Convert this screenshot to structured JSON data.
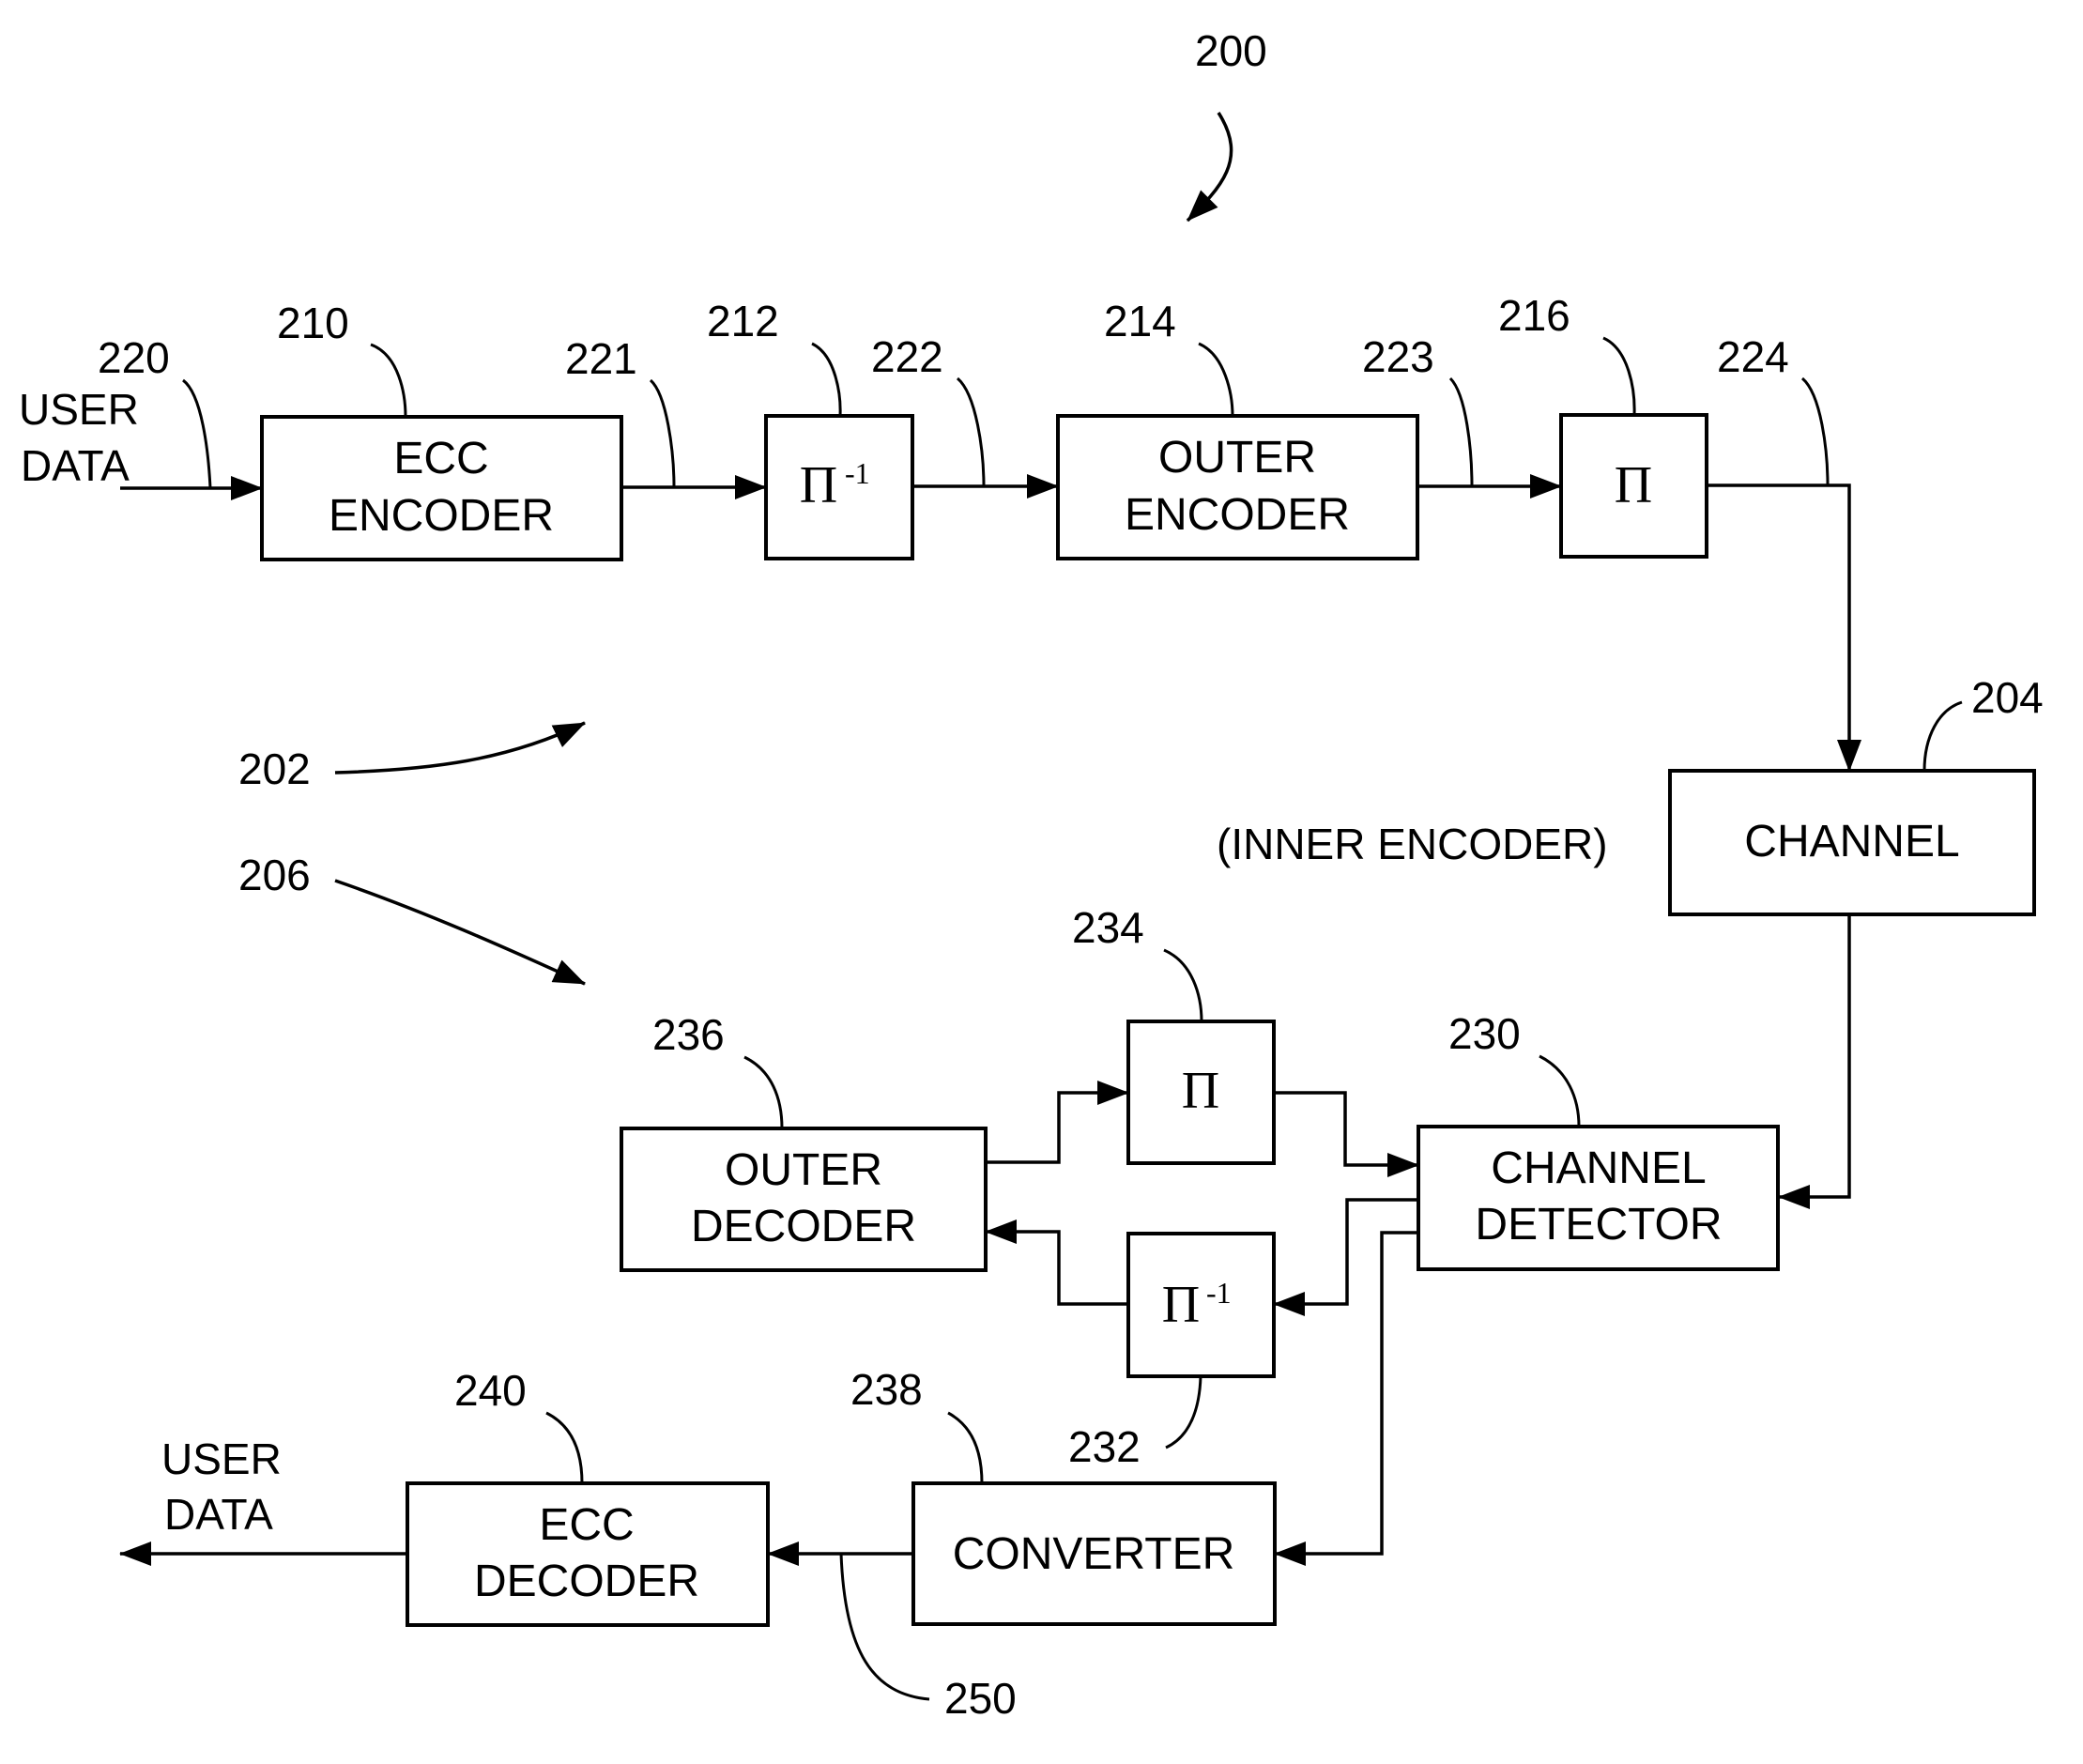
{
  "figure": {
    "ref": "200",
    "encoder_ref": "202",
    "channel_ref": "204",
    "decoder_ref": "206"
  },
  "blocks": {
    "ecc_encoder": {
      "ref": "210",
      "line1": "ECC",
      "line2": "ENCODER"
    },
    "deinterleaver_tx": {
      "ref": "212",
      "symbol": "Π",
      "superscript": "-1"
    },
    "outer_encoder": {
      "ref": "214",
      "line1": "OUTER",
      "line2": "ENCODER"
    },
    "interleaver_tx": {
      "ref": "216",
      "symbol": "Π"
    },
    "channel": {
      "ref": "204",
      "label": "CHANNEL",
      "annotation": "(INNER ENCODER)"
    },
    "channel_detector": {
      "ref": "230",
      "line1": "CHANNEL",
      "line2": "DETECTOR"
    },
    "deinterleaver_rx": {
      "ref": "232",
      "symbol": "Π",
      "superscript": "-1"
    },
    "interleaver_rx": {
      "ref": "234",
      "symbol": "Π"
    },
    "outer_decoder": {
      "ref": "236",
      "line1": "OUTER",
      "line2": "DECODER"
    },
    "converter": {
      "ref": "238",
      "label": "CONVERTER"
    },
    "ecc_decoder": {
      "ref": "240",
      "line1": "ECC",
      "line2": "DECODER"
    }
  },
  "signals": {
    "user_data_in": {
      "ref": "220",
      "line1": "USER",
      "line2": "DATA"
    },
    "s221": "221",
    "s222": "222",
    "s223": "223",
    "s224": "224",
    "s250": "250",
    "user_data_out": {
      "line1": "USER",
      "line2": "DATA"
    }
  }
}
